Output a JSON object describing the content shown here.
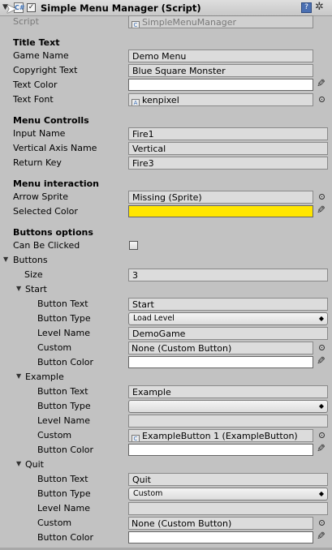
{
  "header": {
    "title": "Simple Menu Manager (Script)",
    "enabled_check": "✓"
  },
  "script_field": {
    "label": "Script",
    "value": "SimpleMenuManager"
  },
  "title_text": {
    "heading": "Title Text",
    "game_name_label": "Game Name",
    "game_name": "Demo Menu",
    "copyright_label": "Copyright Text",
    "copyright": "Blue Square Monster",
    "text_color_label": "Text Color",
    "text_color": "#ffffff",
    "text_font_label": "Text Font",
    "text_font": "kenpixel"
  },
  "menu_controls": {
    "heading": "Menu Controlls",
    "input_name_label": "Input Name",
    "input_name": "Fire1",
    "vertical_axis_label": "Vertical Axis Name",
    "vertical_axis": "Vertical",
    "return_key_label": "Return Key",
    "return_key": "Fire3"
  },
  "menu_interaction": {
    "heading": "Menu interaction",
    "arrow_sprite_label": "Arrow Sprite",
    "arrow_sprite": "Missing (Sprite)",
    "selected_color_label": "Selected Color",
    "selected_color": "#ffe600"
  },
  "buttons_options": {
    "heading": "Buttons options",
    "can_be_clicked_label": "Can Be Clicked",
    "can_be_clicked": false,
    "buttons_label": "Buttons",
    "size_label": "Size",
    "size": "3"
  },
  "button_items": [
    {
      "name": "Start",
      "button_text_label": "Button Text",
      "button_text": "Start",
      "button_type_label": "Button Type",
      "button_type": "Load Level",
      "level_name_label": "Level Name",
      "level_name": "DemoGame",
      "custom_label": "Custom",
      "custom": "None (Custom Button)",
      "button_color_label": "Button Color",
      "button_color": "#ffffff"
    },
    {
      "name": "Example",
      "button_text_label": "Button Text",
      "button_text": "Example",
      "button_type_label": "Button Type",
      "button_type": "",
      "level_name_label": "Level Name",
      "level_name": "",
      "custom_label": "Custom",
      "custom": "ExampleButton 1 (ExampleButton)",
      "button_color_label": "Button Color",
      "button_color": "#ffffff"
    },
    {
      "name": "Quit",
      "button_text_label": "Button Text",
      "button_text": "Quit",
      "button_type_label": "Button Type",
      "button_type": "Custom",
      "level_name_label": "Level Name",
      "level_name": "",
      "custom_label": "Custom",
      "custom": "None (Custom Button)",
      "button_color_label": "Button Color",
      "button_color": "#ffffff"
    }
  ]
}
